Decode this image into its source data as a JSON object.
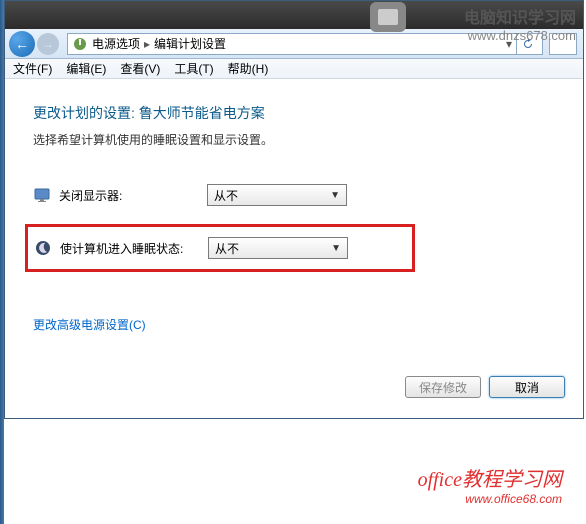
{
  "navbar": {
    "breadcrumb1": "电源选项",
    "breadcrumb2": "编辑计划设置"
  },
  "menubar": {
    "file": "文件(F)",
    "edit": "编辑(E)",
    "view": "查看(V)",
    "tools": "工具(T)",
    "help": "帮助(H)"
  },
  "page": {
    "title": "更改计划的设置: 鲁大师节能省电方案",
    "desc": "选择希望计算机使用的睡眠设置和显示设置。"
  },
  "settings": {
    "display_off": {
      "label": "关闭显示器:",
      "value": "从不"
    },
    "sleep": {
      "label": "使计算机进入睡眠状态:",
      "value": "从不"
    }
  },
  "links": {
    "advanced": "更改高级电源设置(C)"
  },
  "buttons": {
    "save": "保存修改",
    "cancel": "取消"
  },
  "watermark": {
    "top_line1": "电脑知识学习网",
    "top_line2": "www.dnzs678.com",
    "bottom_line1": "office教程学习网",
    "bottom_line2": "www.office68.com"
  }
}
